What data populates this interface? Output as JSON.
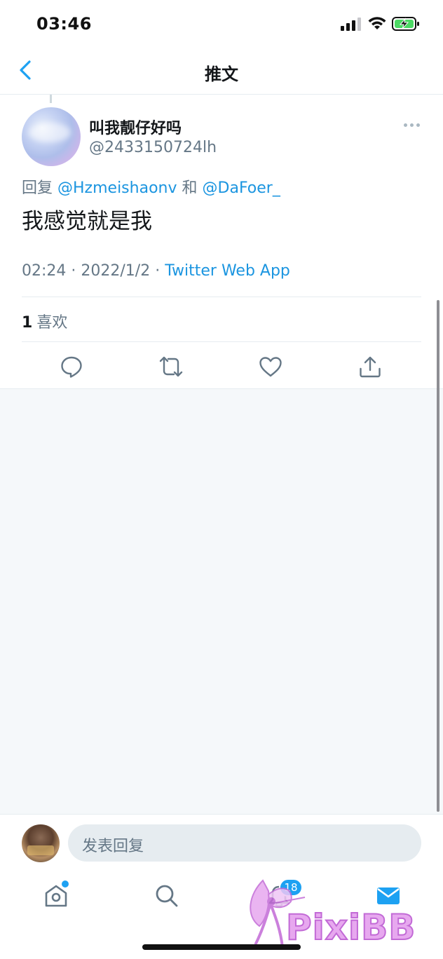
{
  "status_bar": {
    "time": "03:46"
  },
  "header": {
    "title": "推文"
  },
  "tweet": {
    "author_name": "叫我靓仔好吗",
    "author_handle": "@2433150724lh",
    "reply_prefix": "回复",
    "reply_to_1": "@Hzmeishaonv",
    "reply_and": "和",
    "reply_to_2": "@DaFoer_",
    "text": "我感觉就是我",
    "time": "02:24",
    "date": "2022/1/2",
    "source": "Twitter Web App",
    "like_count": "1",
    "like_label": "喜欢"
  },
  "compose": {
    "placeholder": "发表回复"
  },
  "tab_bar": {
    "messages_badge": "18"
  },
  "watermark": {
    "text": "PixiBB"
  },
  "colors": {
    "accent": "#1da1f2",
    "link": "#1b95e0",
    "muted": "#657786"
  }
}
